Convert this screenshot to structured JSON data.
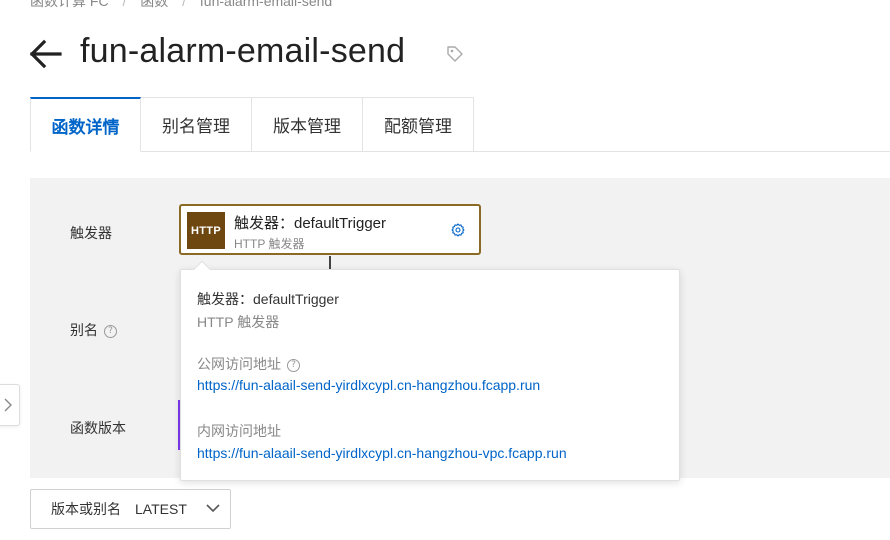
{
  "breadcrumb": {
    "items": [
      "函数计算 FC",
      "函数",
      "fun-alarm-email-send"
    ],
    "separator": "/"
  },
  "page": {
    "title": "fun-alarm-email-send"
  },
  "tabs": [
    {
      "label": "函数详情",
      "active": true
    },
    {
      "label": "别名管理",
      "active": false
    },
    {
      "label": "版本管理",
      "active": false
    },
    {
      "label": "配额管理",
      "active": false
    }
  ],
  "rows": {
    "trigger_label": "触发器",
    "alias_label": "别名",
    "version_label": "函数版本"
  },
  "trigger_card": {
    "badge": "HTTP",
    "name": "触发器：defaultTrigger",
    "type": "HTTP 触发器"
  },
  "popover": {
    "title": "触发器：defaultTrigger",
    "subtitle": "HTTP 触发器",
    "public_label": "公网访问地址",
    "public_url": "https://fun-alaail-send-yirdlxcypl.cn-hangzhou.fcapp.run",
    "private_label": "内网访问地址",
    "private_url": "https://fun-alaail-send-yirdlxcypl.cn-hangzhou-vpc.fcapp.run"
  },
  "version_select": {
    "label": "版本或别名",
    "value": "LATEST"
  },
  "colors": {
    "accent": "#0064c8",
    "trigger_border": "#8a6a24",
    "http_badge": "#6e4710",
    "panel_bg": "#f2f2f2",
    "version_marker": "#7c3aed"
  },
  "icons": [
    "arrow-left-icon",
    "tag-icon",
    "help-icon",
    "gear-icon",
    "chevron-right-icon",
    "chevron-down-icon"
  ]
}
